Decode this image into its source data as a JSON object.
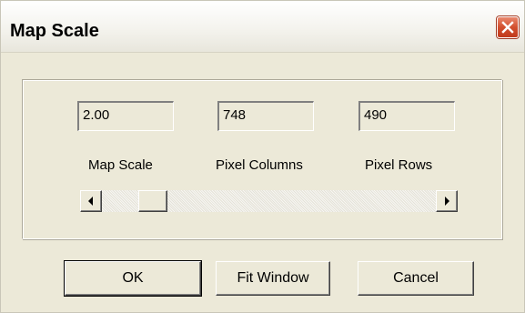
{
  "window": {
    "title": "Map Scale"
  },
  "fields": {
    "map_scale": {
      "value": "2.00",
      "label": "Map Scale"
    },
    "pixel_columns": {
      "value": "748",
      "label": "Pixel Columns"
    },
    "pixel_rows": {
      "value": "490",
      "label": "Pixel Rows"
    }
  },
  "slider": {
    "level_fraction": 0.12
  },
  "buttons": {
    "ok": "OK",
    "fit_window": "Fit Window",
    "cancel": "Cancel"
  },
  "colors": {
    "dialog_background": "#ece9d8",
    "close_button": "#d24f2e"
  }
}
